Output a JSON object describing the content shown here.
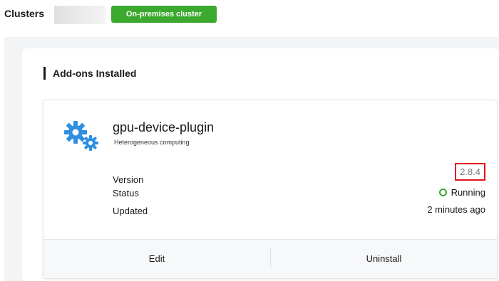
{
  "header": {
    "title": "Clusters",
    "cluster_type_badge": "On-premises cluster",
    "badge_color": "#3aa92e"
  },
  "section": {
    "title": "Add-ons Installed"
  },
  "addon": {
    "icon": "gears-icon",
    "icon_color": "#2f8fe0",
    "name": "gpu-device-plugin",
    "description": "Heterogeneous computing",
    "version_label": "Version",
    "version_value": "2.8.4",
    "status_label": "Status",
    "status_value": "Running",
    "status_color": "#3aa92e",
    "updated_label": "Updated",
    "updated_value": "2 minutes ago",
    "actions": {
      "edit": "Edit",
      "uninstall": "Uninstall"
    }
  },
  "highlight_color": "#e0141d"
}
